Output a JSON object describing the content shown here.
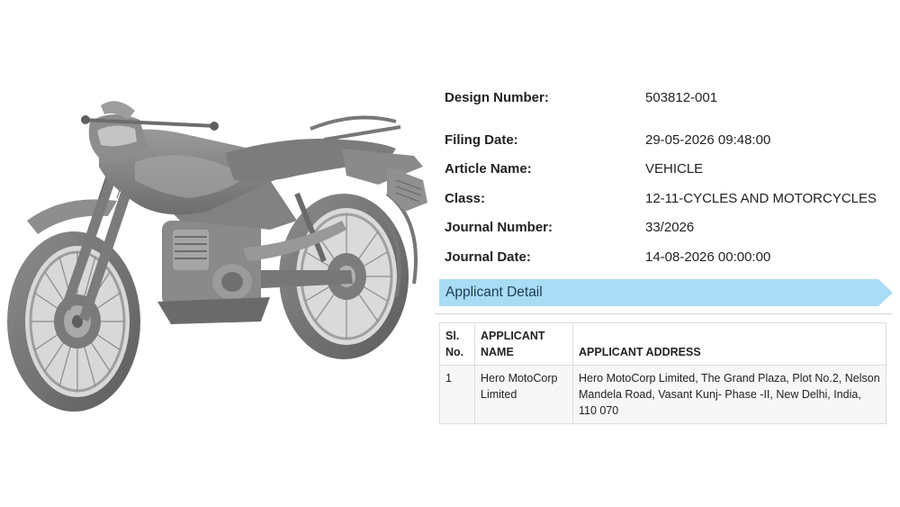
{
  "details": {
    "design_number": {
      "label": "Design Number:",
      "value": "503812-001"
    },
    "filing_date": {
      "label": "Filing Date:",
      "value": "29-05-2026 09:48:00"
    },
    "article_name": {
      "label": "Article Name:",
      "value": "VEHICLE"
    },
    "class": {
      "label": "Class:",
      "value": "12-11-CYCLES AND MOTORCYCLES"
    },
    "journal_number": {
      "label": "Journal Number:",
      "value": "33/2026"
    },
    "journal_date": {
      "label": "Journal Date:",
      "value": "14-08-2026 00:00:00"
    }
  },
  "banner": {
    "title": "Applicant Detail",
    "color": "#a9dcf5"
  },
  "table": {
    "headers": {
      "sl_line1": "Sl.",
      "sl_line2": "No.",
      "name_line1": "APPLICANT",
      "name_line2": "NAME",
      "address": "APPLICANT ADDRESS"
    },
    "rows": [
      {
        "sl": "1",
        "name": "Hero MotoCorp Limited",
        "address": "Hero MotoCorp Limited, The Grand Plaza, Plot No.2, Nelson Mandela Road, Vasant Kunj- Phase -II, New Delhi, India, 110 070"
      }
    ]
  },
  "image": {
    "icon": "motorcycle-design-drawing"
  }
}
